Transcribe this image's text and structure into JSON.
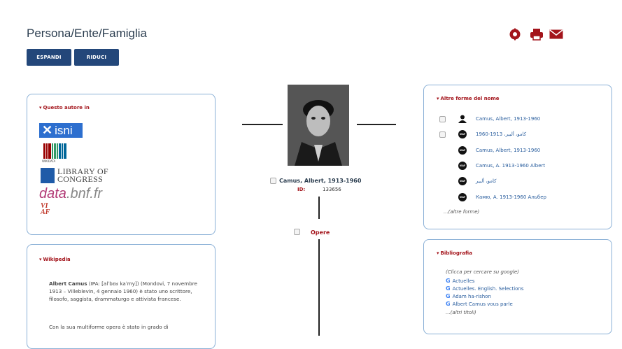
{
  "header": {
    "title": "Persona/Ente/Famiglia",
    "expand_label": "ESPANDI",
    "reduce_label": "RIDUCI"
  },
  "questo_autore": {
    "title": "Questo autore in",
    "isni": "isni",
    "wikidata": "WIKIDATA",
    "loc_line1": "LIBRARY OF",
    "loc_line2": "CONGRESS",
    "bnf_a": "data",
    "bnf_b": ".bnf.fr",
    "viaf_line1": "VI",
    "viaf_line2": "AF"
  },
  "wikipedia": {
    "title": "Wikipedia",
    "p1_name": "Albert Camus",
    "p1_rest": " (IPA: [alˈbɛʁ kaˈmy]) (Mondovi, 7 novembre 1913 – Villeblevin, 4 gennaio 1960) è stato uno scrittore, filosofo, saggista, drammaturgo e attivista francese.",
    "p2": "Con la sua multiforme opera è stato in grado di"
  },
  "center": {
    "name": "Camus, Albert, 1913-1960",
    "id_label": "ID:",
    "id_value": "133656",
    "opere": "Opere"
  },
  "altre_forme": {
    "title": "Altre forme del nome",
    "items": [
      {
        "text": "Camus, Albert, 1913-1960",
        "icon": "person-icon",
        "checkbox": true
      },
      {
        "text": "1960-1913 ،كامو، ألبير",
        "icon": "viaf-icon",
        "checkbox": true
      },
      {
        "text": "Camus, Albert, 1913-1960",
        "icon": "viaf-icon",
        "checkbox": false
      },
      {
        "text": "Camus, A. 1913-1960 Albert",
        "icon": "viaf-icon",
        "checkbox": false
      },
      {
        "text": "كامو، ألبير",
        "icon": "viaf-icon",
        "checkbox": false
      },
      {
        "text": "Камю, А. 1913-1960 Альбер",
        "icon": "viaf-icon",
        "checkbox": false
      }
    ],
    "more": "...(altre forme)"
  },
  "bibliografia": {
    "title": "Bibliografia",
    "hint": "(Clicca per cercare su google)",
    "items": [
      "Actuelles",
      "Actuelles. English. Selections",
      "Adam ha-rishon",
      "Albert Camus vous parle"
    ],
    "more": "...(altri titoli)"
  },
  "colors": {
    "accent_red": "#a3141b",
    "button_blue": "#23477a",
    "panel_border": "#8ab0d6",
    "link_blue": "#2a5e9e"
  }
}
